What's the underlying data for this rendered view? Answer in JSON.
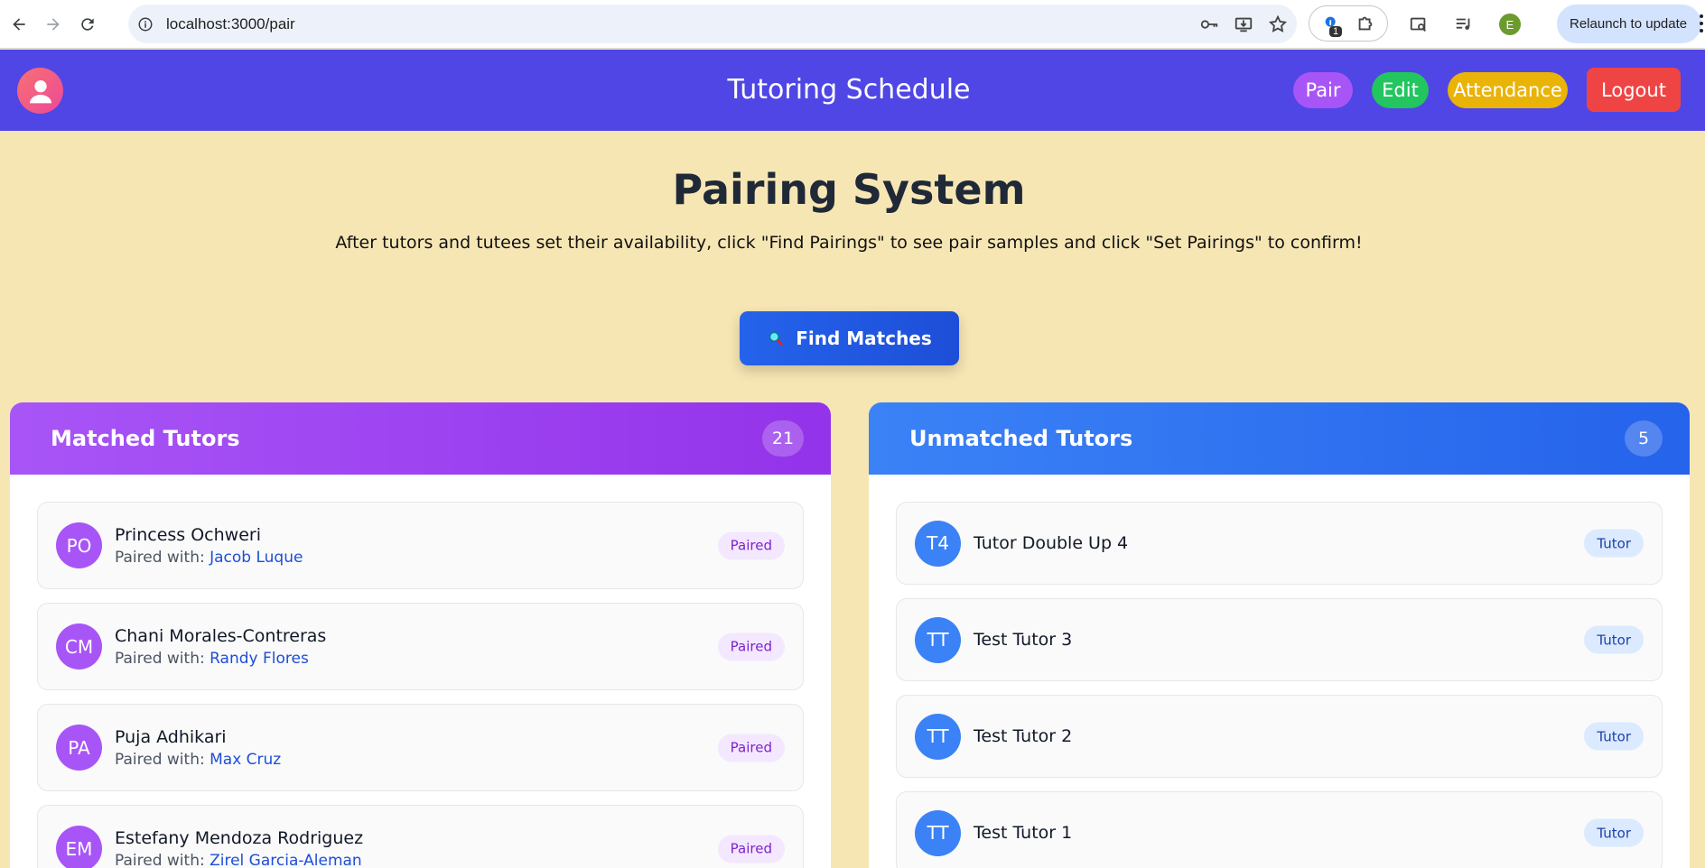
{
  "browser": {
    "url": "localhost:3000/pair",
    "extension_badge": "1",
    "profile_initial": "E",
    "relaunch_label": "Relaunch to update"
  },
  "header": {
    "title": "Tutoring Schedule",
    "nav": {
      "pair": "Pair",
      "edit": "Edit",
      "attendance": "Attendance",
      "logout": "Logout"
    },
    "colors": {
      "bar": "#4f46e5",
      "pair": "#a855f7",
      "edit": "#22c55e",
      "attendance": "#eab308",
      "logout": "#ef4444"
    }
  },
  "hero": {
    "title": "Pairing System",
    "subtitle": "After tutors and tutees set their availability, click \"Find Pairings\" to see pair samples and click \"Set Pairings\" to confirm!",
    "find_button": "Find Matches"
  },
  "matched": {
    "title": "Matched Tutors",
    "count": "21",
    "paired_prefix": "Paired with:",
    "items": [
      {
        "initials": "PO",
        "name": "Princess Ochweri",
        "partner": "Jacob Luque",
        "status": "Paired"
      },
      {
        "initials": "CM",
        "name": "Chani Morales-Contreras",
        "partner": "Randy Flores",
        "status": "Paired"
      },
      {
        "initials": "PA",
        "name": "Puja Adhikari",
        "partner": "Max Cruz",
        "status": "Paired"
      },
      {
        "initials": "EM",
        "name": "Estefany Mendoza Rodriguez",
        "partner": "Zirel Garcia-Aleman",
        "status": "Paired"
      }
    ]
  },
  "unmatched": {
    "title": "Unmatched Tutors",
    "count": "5",
    "items": [
      {
        "initials": "T4",
        "name": "Tutor Double Up 4",
        "role": "Tutor"
      },
      {
        "initials": "TT",
        "name": "Test Tutor 3",
        "role": "Tutor"
      },
      {
        "initials": "TT",
        "name": "Test Tutor 2",
        "role": "Tutor"
      },
      {
        "initials": "TT",
        "name": "Test Tutor 1",
        "role": "Tutor"
      }
    ]
  },
  "page_background": "#f6e6b4"
}
